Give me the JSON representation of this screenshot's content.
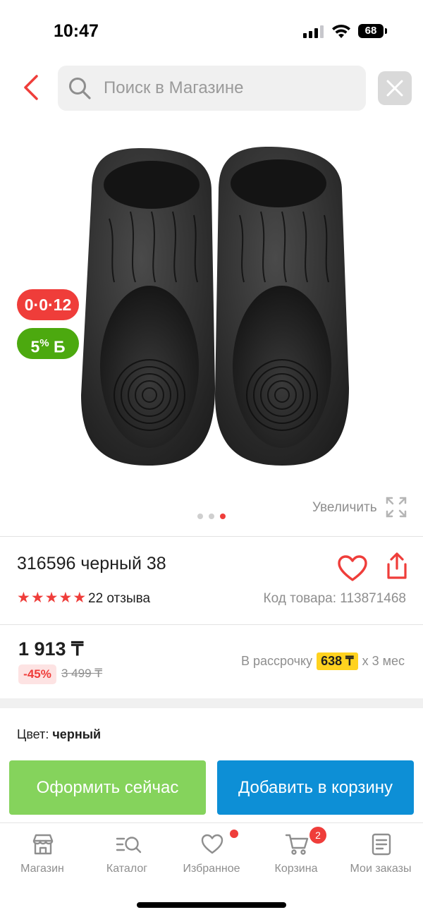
{
  "status_bar": {
    "time": "10:47",
    "battery": "68"
  },
  "header": {
    "back_icon": "chevron-left-icon",
    "search": {
      "placeholder": "Поиск в Магазине",
      "value": "",
      "icon": "search-icon"
    },
    "clear_icon": "close-icon"
  },
  "gallery": {
    "badges": {
      "installment": "0·0·12",
      "bonus_value": "5",
      "bonus_unit": "%",
      "bonus_currency": "Б"
    },
    "zoom_label": "Увеличить",
    "slide_count": 3,
    "active_slide": 3
  },
  "product": {
    "title": "316596 черный 38",
    "rating_stars": 5,
    "reviews": "22 отзыва",
    "sku": "Код товара: 113871468"
  },
  "price": {
    "current": "1 913 ₸",
    "discount": "-45%",
    "old": "3 499 ₸",
    "installment_prefix": "В рассрочку",
    "installment_amount": "638 ₸",
    "installment_suffix": "x 3 мес"
  },
  "options": {
    "color_label": "Цвет:",
    "color_value": "черный"
  },
  "actions": {
    "buy_now": "Оформить сейчас",
    "add_to_cart": "Добавить в корзину"
  },
  "tabbar": {
    "items": [
      {
        "label": "Магазин",
        "icon": "store-icon"
      },
      {
        "label": "Каталог",
        "icon": "catalog-search-icon"
      },
      {
        "label": "Избранное",
        "icon": "heart-icon"
      },
      {
        "label": "Корзина",
        "icon": "cart-icon"
      },
      {
        "label": "Мои заказы",
        "icon": "orders-icon"
      }
    ],
    "cart_count": "2"
  },
  "colors": {
    "accent_red": "#ef3d3a",
    "green": "#85d35c",
    "blue": "#0d8fd6",
    "installment_yellow": "#ffd21f"
  }
}
